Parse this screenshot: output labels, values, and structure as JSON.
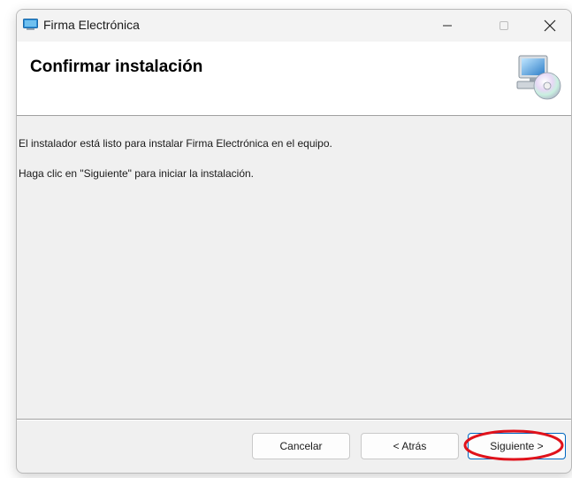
{
  "window": {
    "title": "Firma Electrónica"
  },
  "header": {
    "title": "Confirmar instalación"
  },
  "content": {
    "line1": "El instalador está listo para instalar Firma Electrónica en el equipo.",
    "line2": "Haga clic en \"Siguiente\" para iniciar la instalación."
  },
  "buttons": {
    "cancel": "Cancelar",
    "back": "< Atrás",
    "next": "Siguiente >"
  },
  "colors": {
    "accent": "#0067c0",
    "highlight": "#e0121b"
  },
  "icons": [
    "installer-app-icon",
    "minimize-icon",
    "maximize-icon",
    "close-icon",
    "computer-cd-icon"
  ]
}
